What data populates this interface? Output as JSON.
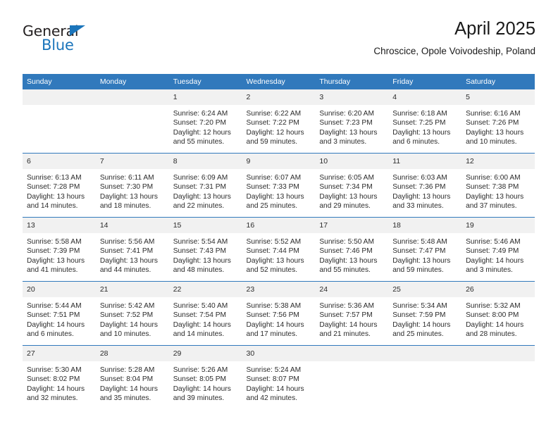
{
  "brand": {
    "name_part1": "General",
    "name_part2": "Blue",
    "triangle_icon": "blue-triangle-icon"
  },
  "header": {
    "title": "April 2025",
    "subtitle": "Chroscice, Opole Voivodeship, Poland"
  },
  "colors": {
    "header_blue": "#3179bc",
    "brand_blue": "#1b75bb",
    "daynum_band": "#f1f1f1",
    "text": "#2b2b2b"
  },
  "weekday_headers": [
    "Sunday",
    "Monday",
    "Tuesday",
    "Wednesday",
    "Thursday",
    "Friday",
    "Saturday"
  ],
  "weeks": [
    [
      {
        "day": "",
        "sunrise": "",
        "sunset": "",
        "daylight_1": "",
        "daylight_2": ""
      },
      {
        "day": "",
        "sunrise": "",
        "sunset": "",
        "daylight_1": "",
        "daylight_2": ""
      },
      {
        "day": "1",
        "sunrise": "Sunrise: 6:24 AM",
        "sunset": "Sunset: 7:20 PM",
        "daylight_1": "Daylight: 12 hours",
        "daylight_2": "and 55 minutes."
      },
      {
        "day": "2",
        "sunrise": "Sunrise: 6:22 AM",
        "sunset": "Sunset: 7:22 PM",
        "daylight_1": "Daylight: 12 hours",
        "daylight_2": "and 59 minutes."
      },
      {
        "day": "3",
        "sunrise": "Sunrise: 6:20 AM",
        "sunset": "Sunset: 7:23 PM",
        "daylight_1": "Daylight: 13 hours",
        "daylight_2": "and 3 minutes."
      },
      {
        "day": "4",
        "sunrise": "Sunrise: 6:18 AM",
        "sunset": "Sunset: 7:25 PM",
        "daylight_1": "Daylight: 13 hours",
        "daylight_2": "and 6 minutes."
      },
      {
        "day": "5",
        "sunrise": "Sunrise: 6:16 AM",
        "sunset": "Sunset: 7:26 PM",
        "daylight_1": "Daylight: 13 hours",
        "daylight_2": "and 10 minutes."
      }
    ],
    [
      {
        "day": "6",
        "sunrise": "Sunrise: 6:13 AM",
        "sunset": "Sunset: 7:28 PM",
        "daylight_1": "Daylight: 13 hours",
        "daylight_2": "and 14 minutes."
      },
      {
        "day": "7",
        "sunrise": "Sunrise: 6:11 AM",
        "sunset": "Sunset: 7:30 PM",
        "daylight_1": "Daylight: 13 hours",
        "daylight_2": "and 18 minutes."
      },
      {
        "day": "8",
        "sunrise": "Sunrise: 6:09 AM",
        "sunset": "Sunset: 7:31 PM",
        "daylight_1": "Daylight: 13 hours",
        "daylight_2": "and 22 minutes."
      },
      {
        "day": "9",
        "sunrise": "Sunrise: 6:07 AM",
        "sunset": "Sunset: 7:33 PM",
        "daylight_1": "Daylight: 13 hours",
        "daylight_2": "and 25 minutes."
      },
      {
        "day": "10",
        "sunrise": "Sunrise: 6:05 AM",
        "sunset": "Sunset: 7:34 PM",
        "daylight_1": "Daylight: 13 hours",
        "daylight_2": "and 29 minutes."
      },
      {
        "day": "11",
        "sunrise": "Sunrise: 6:03 AM",
        "sunset": "Sunset: 7:36 PM",
        "daylight_1": "Daylight: 13 hours",
        "daylight_2": "and 33 minutes."
      },
      {
        "day": "12",
        "sunrise": "Sunrise: 6:00 AM",
        "sunset": "Sunset: 7:38 PM",
        "daylight_1": "Daylight: 13 hours",
        "daylight_2": "and 37 minutes."
      }
    ],
    [
      {
        "day": "13",
        "sunrise": "Sunrise: 5:58 AM",
        "sunset": "Sunset: 7:39 PM",
        "daylight_1": "Daylight: 13 hours",
        "daylight_2": "and 41 minutes."
      },
      {
        "day": "14",
        "sunrise": "Sunrise: 5:56 AM",
        "sunset": "Sunset: 7:41 PM",
        "daylight_1": "Daylight: 13 hours",
        "daylight_2": "and 44 minutes."
      },
      {
        "day": "15",
        "sunrise": "Sunrise: 5:54 AM",
        "sunset": "Sunset: 7:43 PM",
        "daylight_1": "Daylight: 13 hours",
        "daylight_2": "and 48 minutes."
      },
      {
        "day": "16",
        "sunrise": "Sunrise: 5:52 AM",
        "sunset": "Sunset: 7:44 PM",
        "daylight_1": "Daylight: 13 hours",
        "daylight_2": "and 52 minutes."
      },
      {
        "day": "17",
        "sunrise": "Sunrise: 5:50 AM",
        "sunset": "Sunset: 7:46 PM",
        "daylight_1": "Daylight: 13 hours",
        "daylight_2": "and 55 minutes."
      },
      {
        "day": "18",
        "sunrise": "Sunrise: 5:48 AM",
        "sunset": "Sunset: 7:47 PM",
        "daylight_1": "Daylight: 13 hours",
        "daylight_2": "and 59 minutes."
      },
      {
        "day": "19",
        "sunrise": "Sunrise: 5:46 AM",
        "sunset": "Sunset: 7:49 PM",
        "daylight_1": "Daylight: 14 hours",
        "daylight_2": "and 3 minutes."
      }
    ],
    [
      {
        "day": "20",
        "sunrise": "Sunrise: 5:44 AM",
        "sunset": "Sunset: 7:51 PM",
        "daylight_1": "Daylight: 14 hours",
        "daylight_2": "and 6 minutes."
      },
      {
        "day": "21",
        "sunrise": "Sunrise: 5:42 AM",
        "sunset": "Sunset: 7:52 PM",
        "daylight_1": "Daylight: 14 hours",
        "daylight_2": "and 10 minutes."
      },
      {
        "day": "22",
        "sunrise": "Sunrise: 5:40 AM",
        "sunset": "Sunset: 7:54 PM",
        "daylight_1": "Daylight: 14 hours",
        "daylight_2": "and 14 minutes."
      },
      {
        "day": "23",
        "sunrise": "Sunrise: 5:38 AM",
        "sunset": "Sunset: 7:56 PM",
        "daylight_1": "Daylight: 14 hours",
        "daylight_2": "and 17 minutes."
      },
      {
        "day": "24",
        "sunrise": "Sunrise: 5:36 AM",
        "sunset": "Sunset: 7:57 PM",
        "daylight_1": "Daylight: 14 hours",
        "daylight_2": "and 21 minutes."
      },
      {
        "day": "25",
        "sunrise": "Sunrise: 5:34 AM",
        "sunset": "Sunset: 7:59 PM",
        "daylight_1": "Daylight: 14 hours",
        "daylight_2": "and 25 minutes."
      },
      {
        "day": "26",
        "sunrise": "Sunrise: 5:32 AM",
        "sunset": "Sunset: 8:00 PM",
        "daylight_1": "Daylight: 14 hours",
        "daylight_2": "and 28 minutes."
      }
    ],
    [
      {
        "day": "27",
        "sunrise": "Sunrise: 5:30 AM",
        "sunset": "Sunset: 8:02 PM",
        "daylight_1": "Daylight: 14 hours",
        "daylight_2": "and 32 minutes."
      },
      {
        "day": "28",
        "sunrise": "Sunrise: 5:28 AM",
        "sunset": "Sunset: 8:04 PM",
        "daylight_1": "Daylight: 14 hours",
        "daylight_2": "and 35 minutes."
      },
      {
        "day": "29",
        "sunrise": "Sunrise: 5:26 AM",
        "sunset": "Sunset: 8:05 PM",
        "daylight_1": "Daylight: 14 hours",
        "daylight_2": "and 39 minutes."
      },
      {
        "day": "30",
        "sunrise": "Sunrise: 5:24 AM",
        "sunset": "Sunset: 8:07 PM",
        "daylight_1": "Daylight: 14 hours",
        "daylight_2": "and 42 minutes."
      },
      {
        "day": "",
        "sunrise": "",
        "sunset": "",
        "daylight_1": "",
        "daylight_2": ""
      },
      {
        "day": "",
        "sunrise": "",
        "sunset": "",
        "daylight_1": "",
        "daylight_2": ""
      },
      {
        "day": "",
        "sunrise": "",
        "sunset": "",
        "daylight_1": "",
        "daylight_2": ""
      }
    ]
  ]
}
